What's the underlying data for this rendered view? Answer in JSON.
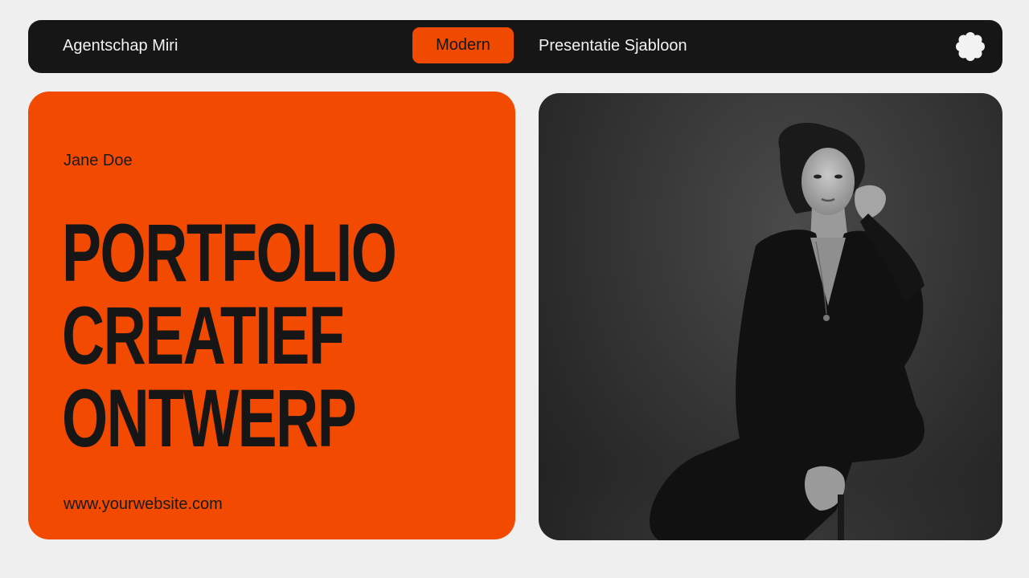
{
  "header": {
    "brand": "Agentschap Miri",
    "pill_label": "Modern",
    "subtitle": "Presentatie Sjabloon",
    "logo_icon": "flower-icon"
  },
  "card": {
    "author": "Jane Doe",
    "headline": [
      "PORTFOLIO",
      "CREATIEF",
      "ONTWERP"
    ],
    "website": "www.yourwebsite.com"
  },
  "photo": {
    "subject": "woman-portrait-photo"
  },
  "colors": {
    "accent": "#F24A00",
    "dark": "#161616",
    "background": "#EFEFF0"
  }
}
